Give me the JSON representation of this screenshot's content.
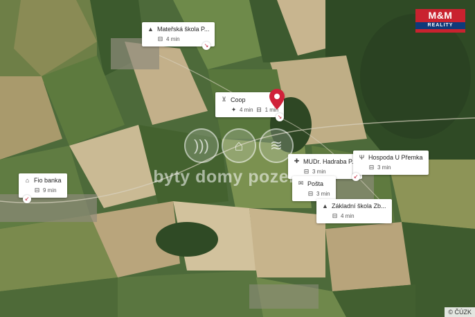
{
  "logo": {
    "brand": "M&M",
    "sub": "REALITY"
  },
  "watermark": {
    "text": "byty domy pozemky"
  },
  "copyright": "© ČÚZK",
  "pois": [
    {
      "id": "materska-skola",
      "icon": "graduation-cap-icon",
      "title": "Mateřská škola P...",
      "meta": [
        {
          "icon": "car-icon",
          "text": "4 min"
        }
      ]
    },
    {
      "id": "coop",
      "icon": "shopping-cart-icon",
      "title": "Coop",
      "meta": [
        {
          "icon": "walk-icon",
          "text": "4 min"
        },
        {
          "icon": "car-icon",
          "text": "1 min"
        }
      ]
    },
    {
      "id": "fio-banka",
      "icon": "bank-icon",
      "title": "Fio banka",
      "meta": [
        {
          "icon": "car-icon",
          "text": "9 min"
        }
      ]
    },
    {
      "id": "mudr-hadraba",
      "icon": "medical-cross-icon",
      "title": "MUDr. Hadraba P...",
      "meta": [
        {
          "icon": "car-icon",
          "text": "3 min"
        }
      ]
    },
    {
      "id": "hospoda",
      "icon": "fork-knife-icon",
      "title": "Hospoda U Přemka",
      "meta": [
        {
          "icon": "car-icon",
          "text": "3 min"
        }
      ]
    },
    {
      "id": "posta",
      "icon": "mail-icon",
      "title": "Pošta",
      "meta": [
        {
          "icon": "car-icon",
          "text": "3 min"
        }
      ]
    },
    {
      "id": "zakladni-skola",
      "icon": "graduation-cap-icon",
      "title": "Základní škola Zb...",
      "meta": [
        {
          "icon": "car-icon",
          "text": "4 min"
        }
      ]
    }
  ],
  "colors": {
    "pin": "#d0213a",
    "accent": "#c9222f"
  }
}
